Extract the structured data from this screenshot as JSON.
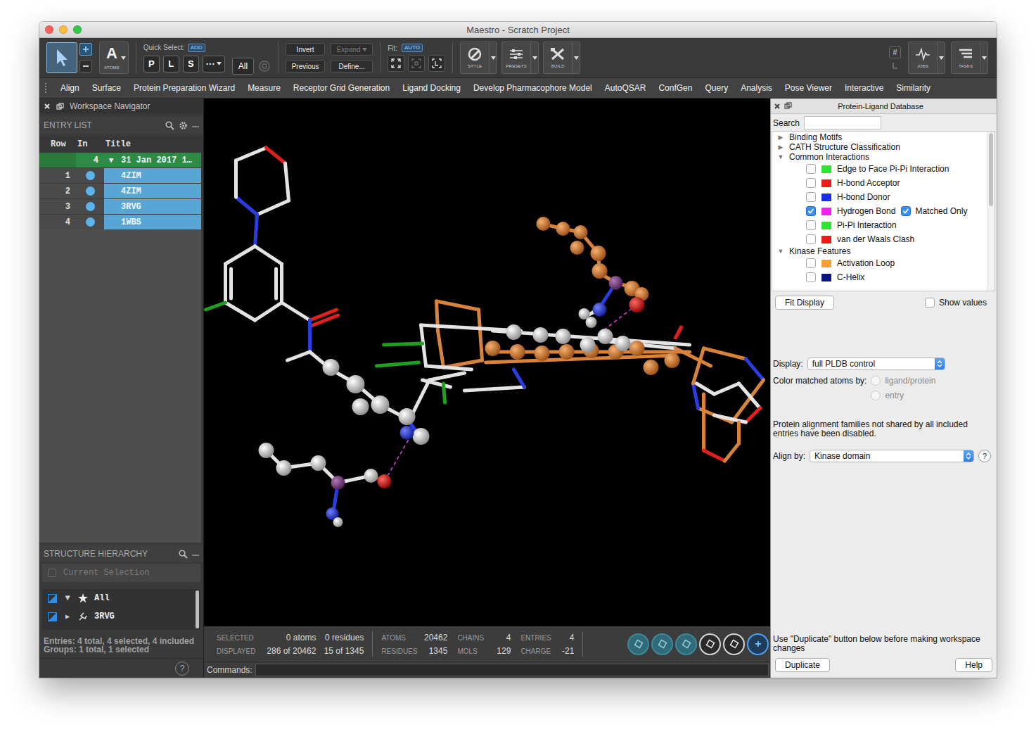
{
  "window": {
    "title": "Maestro - Scratch Project"
  },
  "toolbar": {
    "atoms": {
      "glyph": "A",
      "label": "ATOMS"
    },
    "quick_select": {
      "label": "Quick Select:",
      "badge": "ADD",
      "buttons": [
        "P",
        "L",
        "S",
        "···"
      ],
      "all": "All"
    },
    "selection_buttons": [
      {
        "label": "Invert",
        "disabled": false,
        "kind": "button"
      },
      {
        "label": "Expand",
        "disabled": true,
        "kind": "menu"
      },
      {
        "label": "Previous",
        "disabled": false,
        "kind": "button"
      },
      {
        "label": "Define...",
        "disabled": false,
        "kind": "button"
      }
    ],
    "fit": {
      "label": "Fit:",
      "mode": "AUTO"
    },
    "tools": [
      {
        "label": "STYLE",
        "kind": "style"
      },
      {
        "label": "PRESETS",
        "kind": "presets"
      },
      {
        "label": "BUILD",
        "kind": "build"
      }
    ],
    "grid_glyph": "#",
    "right_tools": [
      {
        "label": "JOBS",
        "kind": "jobs"
      },
      {
        "label": "TASKS",
        "kind": "tasks"
      }
    ]
  },
  "menu": [
    "Align",
    "Surface",
    "Protein Preparation Wizard",
    "Measure",
    "Receptor Grid Generation",
    "Ligand Docking",
    "Develop Pharmacophore Model",
    "AutoQSAR",
    "ConfGen",
    "Query",
    "Analysis",
    "Pose Viewer",
    "Interactive",
    "Similarity"
  ],
  "navigator": {
    "title": "Workspace Navigator",
    "entry_list": {
      "label": "ENTRY LIST",
      "columns": [
        "Row",
        "In",
        "Title"
      ],
      "group": {
        "count": "4",
        "toggle": "▼",
        "title": "31 Jan 2017 1…",
        "expanded": true
      },
      "rows": [
        {
          "row": "1",
          "title": "4ZIM",
          "included": true,
          "selected": true
        },
        {
          "row": "2",
          "title": "4ZIM",
          "included": true,
          "selected": true
        },
        {
          "row": "3",
          "title": "3RVG",
          "included": true,
          "selected": true
        },
        {
          "row": "4",
          "title": "1WBS",
          "included": true,
          "selected": true
        }
      ]
    },
    "hierarchy": {
      "label": "STRUCTURE HIERARCHY",
      "current_selection": "Current Selection",
      "items": [
        {
          "toggle": "▼",
          "label": "All",
          "expanded": true,
          "kind": "all"
        },
        {
          "toggle": "▶",
          "label": "3RVG",
          "expanded": false,
          "kind": "entry"
        }
      ]
    },
    "footer": [
      "Entries: 4 total, 4 selected, 4 included",
      "Groups: 1 total, 1 selected"
    ],
    "help": "?"
  },
  "status_bar": {
    "selection": [
      {
        "label": "SELECTED",
        "atoms": "0 atoms",
        "residues": "0 residues"
      },
      {
        "label": "DISPLAYED",
        "atoms": "286 of 20462",
        "residues": "15 of 1345"
      }
    ],
    "counts": [
      {
        "label": "ATOMS",
        "value": "20462"
      },
      {
        "label": "RESIDUES",
        "value": "1345"
      },
      {
        "label": "CHAINS",
        "value": "4"
      },
      {
        "label": "MOLS",
        "value": "129"
      },
      {
        "label": "ENTRIES",
        "value": "4"
      },
      {
        "label": "CHARGE",
        "value": "-21"
      }
    ]
  },
  "command_line": {
    "label": "Commands:"
  },
  "pldb": {
    "title": "Protein-Ligand Database",
    "search": {
      "label": "Search"
    },
    "tree": [
      {
        "toggle": "▶",
        "label": "Binding Motifs",
        "expanded": false,
        "children": []
      },
      {
        "toggle": "▶",
        "label": "CATH Structure Classification",
        "expanded": false,
        "children": []
      },
      {
        "toggle": "▼",
        "label": "Common Interactions",
        "expanded": true,
        "children": [
          {
            "label": "Edge to Face Pi-Pi Interaction",
            "checked": false,
            "color": "#33e033"
          },
          {
            "label": "H-bond Acceptor",
            "checked": false,
            "color": "#f01818"
          },
          {
            "label": "H-bond Donor",
            "checked": false,
            "color": "#1a2cf0"
          },
          {
            "label": "Hydrogen Bond",
            "checked": true,
            "color": "#f020f0",
            "matched_only": {
              "label": "Matched Only",
              "checked": true
            }
          },
          {
            "label": "Pi-Pi Interaction",
            "checked": false,
            "color": "#33e033"
          },
          {
            "label": "van der Waals Clash",
            "checked": false,
            "color": "#f01818"
          }
        ]
      },
      {
        "toggle": "▼",
        "label": "Kinase Features",
        "expanded": true,
        "children": [
          {
            "label": "Activation Loop",
            "checked": false,
            "color": "#f5a030"
          },
          {
            "label": "C-Helix",
            "checked": false,
            "color": "#0a1680"
          }
        ]
      }
    ],
    "fit_display": "Fit Display",
    "show_values": {
      "label": "Show values",
      "checked": false
    },
    "display": {
      "label": "Display:",
      "value": "full PLDB control"
    },
    "color_by": {
      "label": "Color matched atoms by:",
      "options": [
        {
          "label": "ligand/protein",
          "selected": false,
          "disabled": true
        },
        {
          "label": "entry",
          "selected": false,
          "disabled": true
        }
      ]
    },
    "note": "Protein alignment families not shared by all included entries have been disabled.",
    "align_by": {
      "label": "Align by:",
      "value": "Kinase domain",
      "help": "?"
    },
    "footer_note": "Use \"Duplicate\" button below before making workspace changes",
    "buttons": [
      "Duplicate",
      "Help"
    ]
  }
}
